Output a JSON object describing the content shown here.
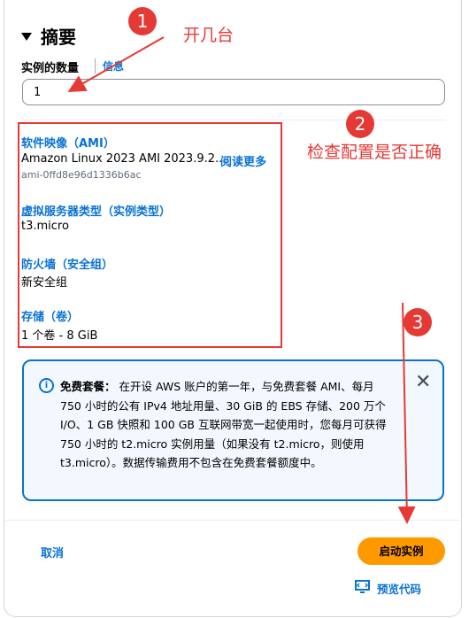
{
  "summary": {
    "title": "摘要",
    "instance_count_label": "实例的数量",
    "info_link": "信息",
    "instance_count_value": "1"
  },
  "details": [
    {
      "label": "软件映像（AMI）",
      "value": "Amazon Linux 2023 AMI 2023.9.2...",
      "extra_link": "阅读更多",
      "sub": "ami-0ffd8e96d1336b6ac"
    },
    {
      "label": "虚拟服务器类型（实例类型）",
      "value": "t3.micro"
    },
    {
      "label": "防火墙（安全组）",
      "value": "新安全组"
    },
    {
      "label": "存储（卷）",
      "value": "1 个卷 - 8 GiB"
    }
  ],
  "free_tier": {
    "title": "免费套餐：",
    "body": "在开设 AWS 账户的第一年，与免费套餐 AMI、每月 750 小时的公有 IPv4 地址用量、30 GiB 的 EBS 存储、200 万个 I/O、1 GB 快照和 100 GB 互联网带宽一起使用时，您每月可获得 750 小时的 t2.micro 实例用量（如果没有 t2.micro，则使用 t3.micro）。数据传输费用不包含在免费套餐额度中。"
  },
  "footer": {
    "cancel_label": "取消",
    "launch_label": "启动实例",
    "preview_label": "预览代码"
  },
  "annotations": {
    "n1": "1",
    "text1": "开几台",
    "n2": "2",
    "text2": "检查配置是否正确",
    "n3": "3",
    "color": "#e53935"
  },
  "colors": {
    "accent": "#0972d3",
    "primary_button": "#ff9900"
  }
}
